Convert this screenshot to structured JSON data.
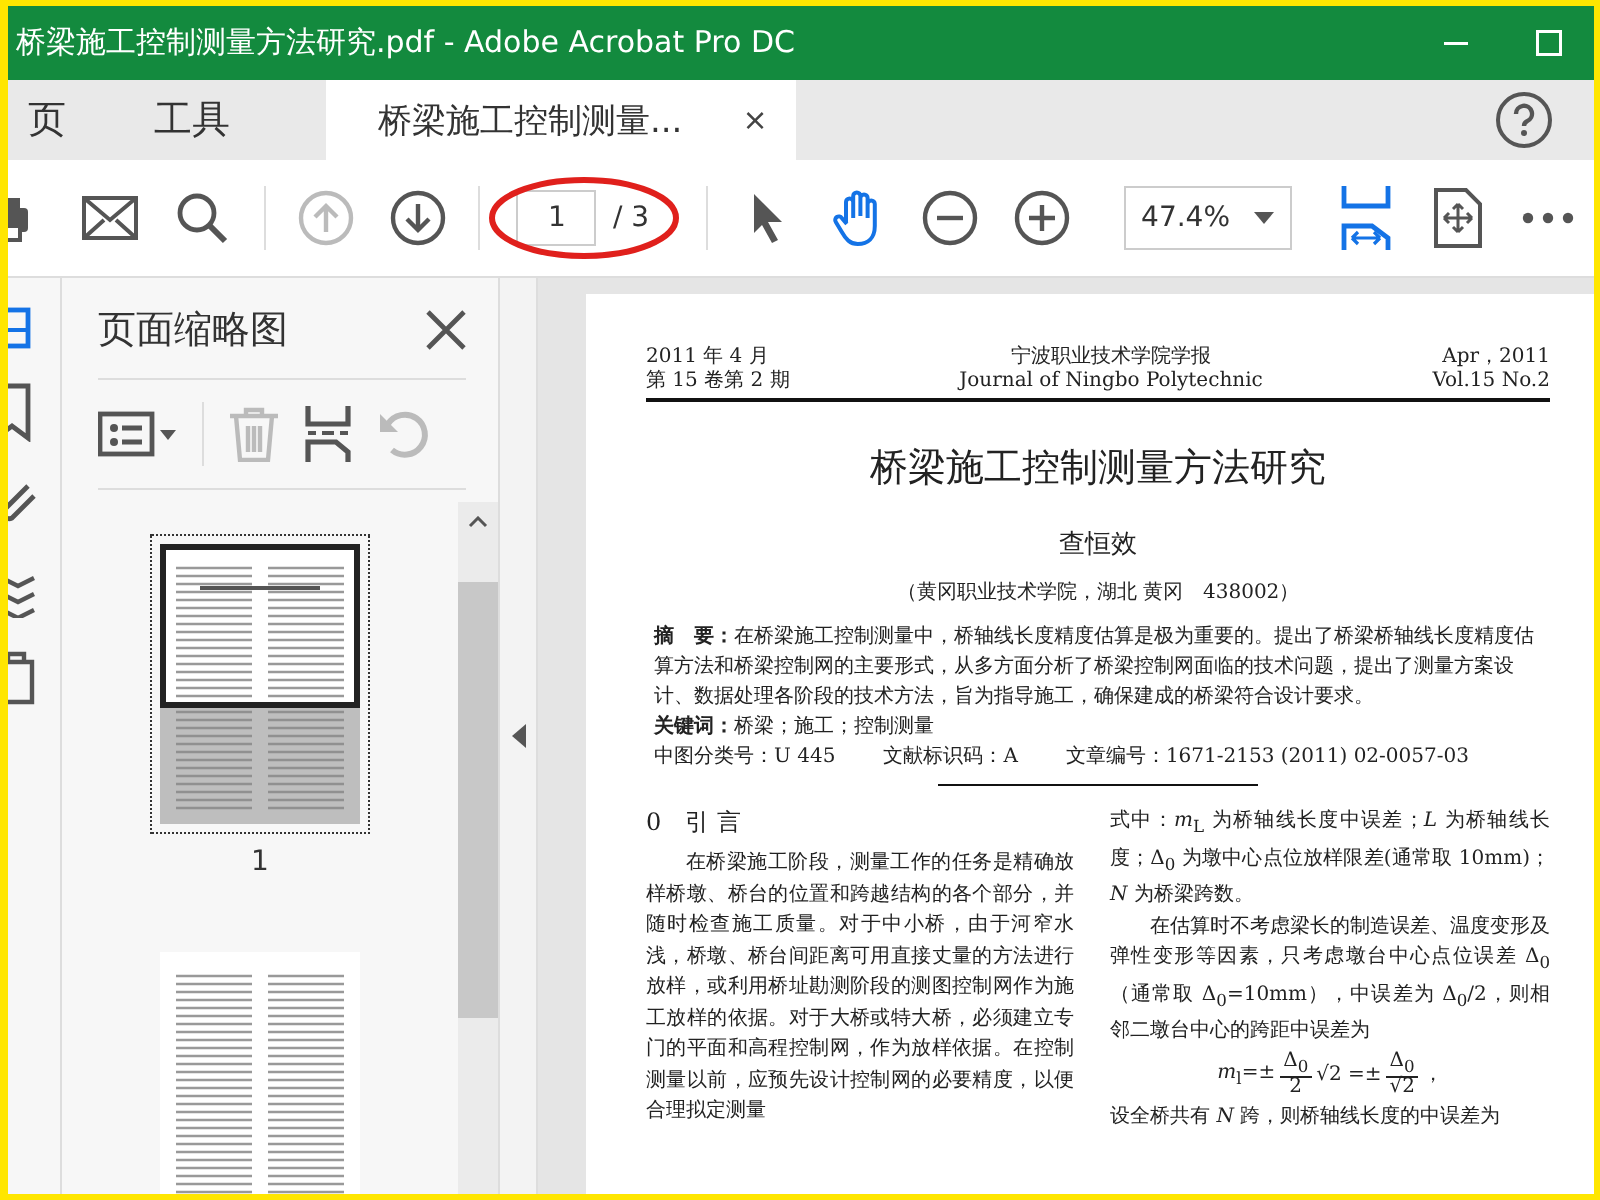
{
  "window": {
    "title": "桥梁施工控制测量方法研究.pdf - Adobe Acrobat Pro DC"
  },
  "tabs": [
    {
      "label": "页",
      "selected": false,
      "kind": "nav"
    },
    {
      "label": "工具",
      "selected": false,
      "kind": "nav"
    },
    {
      "label": "桥梁施工控制测量...",
      "selected": true,
      "kind": "document",
      "close": "×"
    }
  ],
  "toolbar": {
    "tools": [
      {
        "kind": "print",
        "disabled": false
      },
      {
        "kind": "mail",
        "disabled": false
      },
      {
        "kind": "search",
        "disabled": false
      },
      {
        "kind": "prev-page",
        "disabled": true
      },
      {
        "kind": "next-page",
        "disabled": false
      },
      {
        "kind": "page-field",
        "value": "1",
        "total": "/ 3",
        "highlighted": true
      },
      {
        "kind": "select",
        "selected": false
      },
      {
        "kind": "hand",
        "selected": true
      },
      {
        "kind": "zoom-out",
        "disabled": false
      },
      {
        "kind": "zoom-in",
        "disabled": false
      },
      {
        "kind": "zoom-field",
        "value": "47.4%"
      },
      {
        "kind": "fit-page",
        "selected": true
      },
      {
        "kind": "scroll-mode",
        "selected": false
      },
      {
        "kind": "more",
        "disabled": false
      }
    ]
  },
  "thumbnails_panel": {
    "title": "页面缩略图",
    "tools": [
      {
        "kind": "options",
        "disabled": false
      },
      {
        "kind": "delete",
        "disabled": true
      },
      {
        "kind": "insert",
        "disabled": false
      },
      {
        "kind": "rotate",
        "disabled": true
      }
    ],
    "thumbnails": [
      {
        "label": "1",
        "selected": true
      },
      {
        "selected": false
      }
    ]
  },
  "document": {
    "header_left": [
      "2011 年 4 月",
      "第 15 卷第 2 期"
    ],
    "header_center": [
      "宁波职业技术学院学报",
      "Journal of Ningbo Polytechnic"
    ],
    "header_right": [
      "Apr，2011",
      "Vol.15 No.2"
    ],
    "title": "桥梁施工控制测量方法研究",
    "author": "查恒效",
    "affiliation": "（黄冈职业技术学院，湖北 黄冈　438002）",
    "abstract": "**摘　要：**在桥梁施工控制测量中，桥轴线长度精度估算是极为重要的。提出了桥梁桥轴线长度精度估算方法和桥梁控制网的主要形式，从多方面分析了桥梁控制网面临的技术问题，提出了测量方案设计、数据处理各阶段的技术方法，旨为指导施工，确保建成的桥梁符合设计要求。",
    "keywords": "**关键词：**桥梁；施工；控制测量",
    "classification": [
      "中图分类号：U 445",
      "文献标识码：A",
      "文章编号：1671-2153 (2011) 02-0057-03"
    ],
    "section_heading": "0　引 言",
    "left_paragraph": "在桥梁施工阶段，测量工作的任务是精确放样桥墩、桥台的位置和跨越结构的各个部分，并随时检查施工质量。对于中小桥，由于河窄水浅，桥墩、桥台间距离可用直接丈量的方法进行放样，或利用桥址勘测阶段的测图控制网作为施工放样的依据。对于大桥或特大桥，必须建立专门的平面和高程控制网，作为放样依据。在控制测量以前，应预先设计控制网的必要精度，以便合理拟定测量",
    "right_paragraphs": [
      "式中：*m*$_{L}$ 为桥轴线长度中误差；*L* 为桥轴线长度；Δ$_{0}$ 为墩中心点位放样限差(通常取 10mm)；*N* 为桥梁跨数。",
      "在估算时不考虑梁长的制造误差、温度变形及弹性变形等因素，只考虑墩台中心点位误差 Δ$_{0}$（通常取 Δ$_{0}$=10mm），中误差为 Δ$_{0}$/2，则相邻二墩台中心的跨距中误差为"
    ],
    "formula": {
      "lhs": "*m*$_{l}$=±",
      "frac1": {
        "num": "Δ$_{0}$",
        "den": "2"
      },
      "mid": "√2 =±",
      "frac2": {
        "num": "Δ$_{0}$",
        "den": "√2"
      },
      "end": "，"
    },
    "right_last": "设全桥共有 *N* 跨，则桥轴线长度的中误差为"
  }
}
